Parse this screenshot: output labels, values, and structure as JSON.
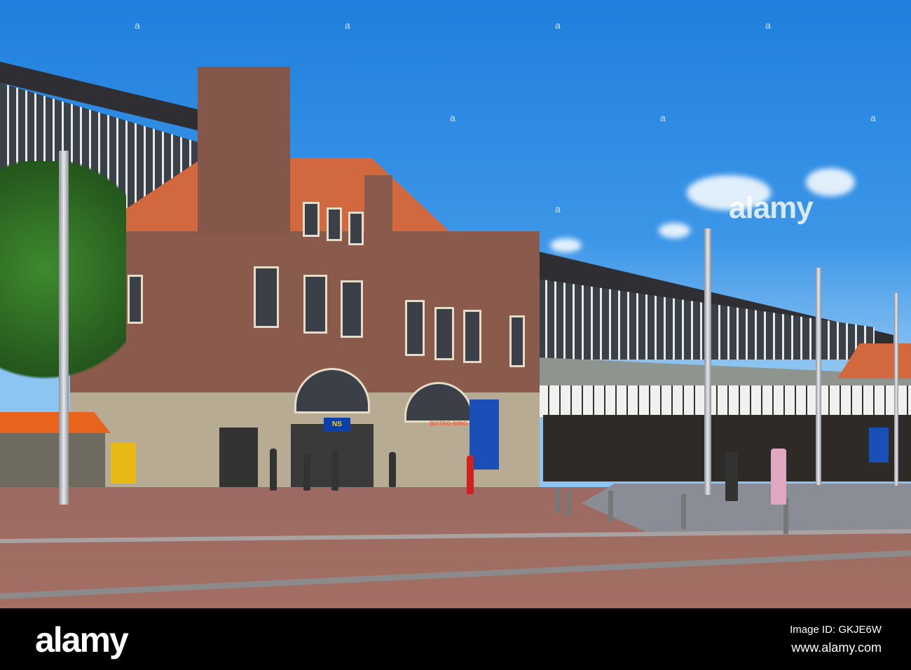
{
  "watermark": {
    "text": "alamy",
    "mark": "a"
  },
  "footer": {
    "logo": "alamy",
    "image_id": "Image ID: GKJE6W",
    "website": "www.alamy.com"
  },
  "signs": {
    "ns_logo": "NS",
    "shop": "BISTRO WING"
  }
}
